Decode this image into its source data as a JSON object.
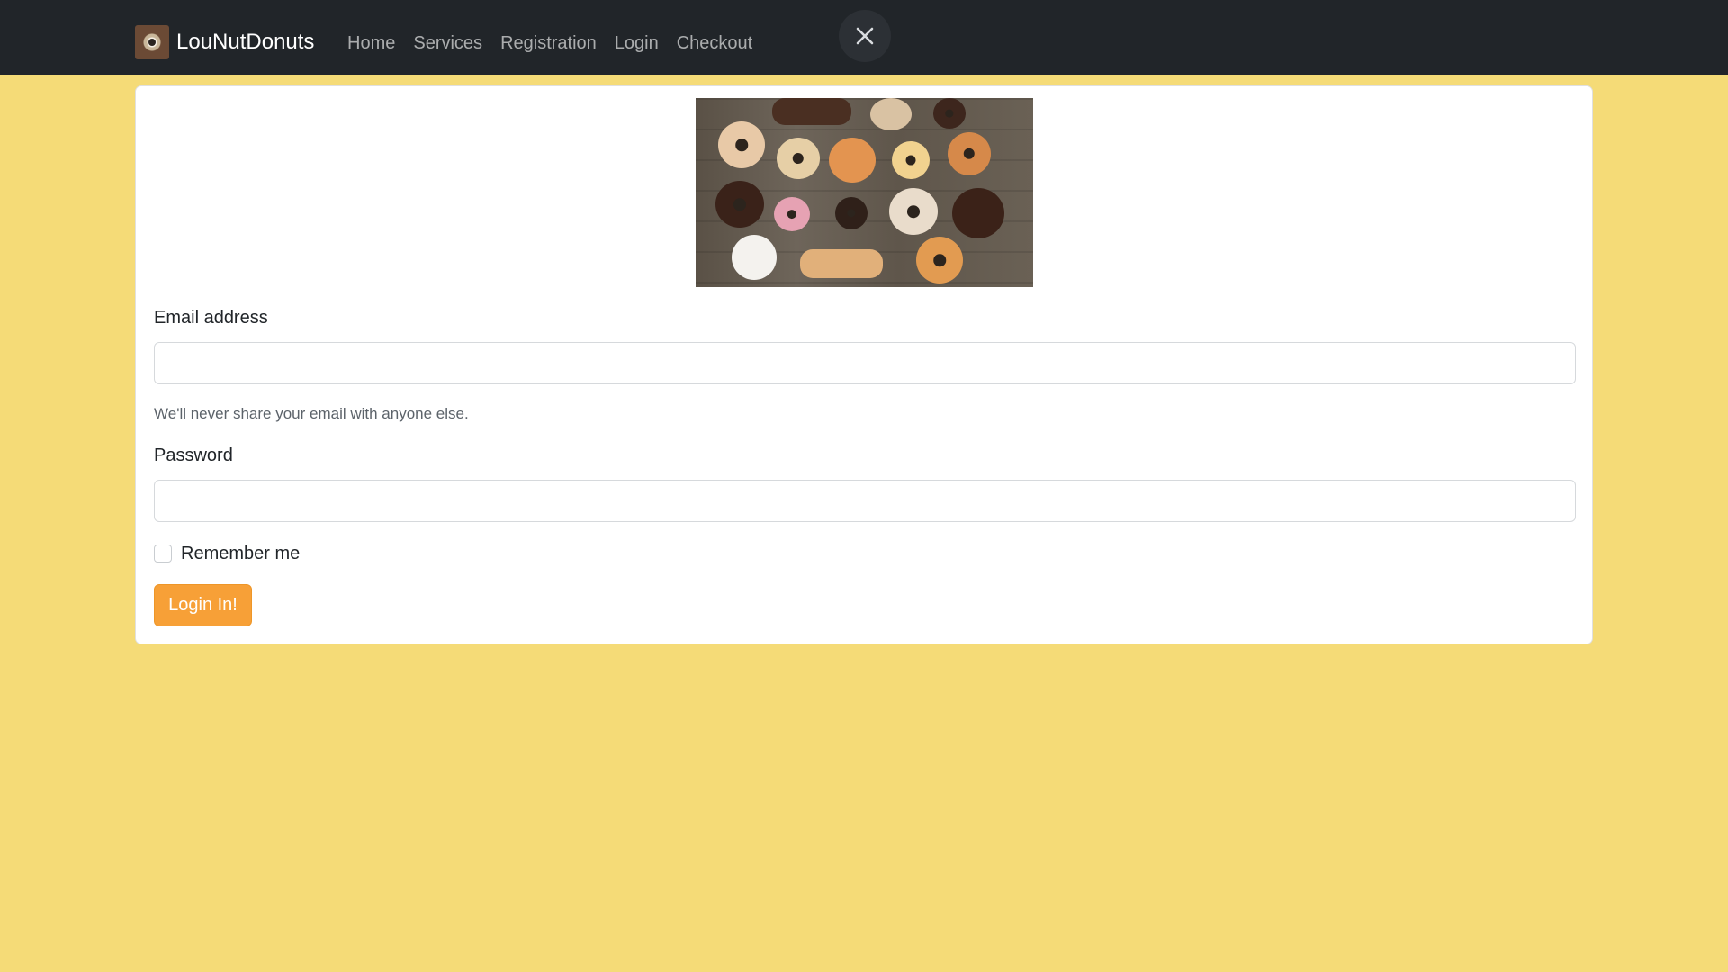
{
  "navbar": {
    "brand": "LouNutDonuts",
    "links": [
      "Home",
      "Services",
      "Registration",
      "Login",
      "Checkout"
    ],
    "close_icon": "close-icon"
  },
  "login_form": {
    "hero_image": "donuts-photo",
    "email_label": "Email address",
    "email_value": "",
    "email_help": "We'll never share your email with anyone else.",
    "password_label": "Password",
    "password_value": "",
    "remember_label": "Remember me",
    "remember_checked": false,
    "submit_label": "Login In!"
  },
  "colors": {
    "page_background": "#f5db77",
    "navbar_background": "#212529",
    "button_accent": "#f7a037"
  }
}
